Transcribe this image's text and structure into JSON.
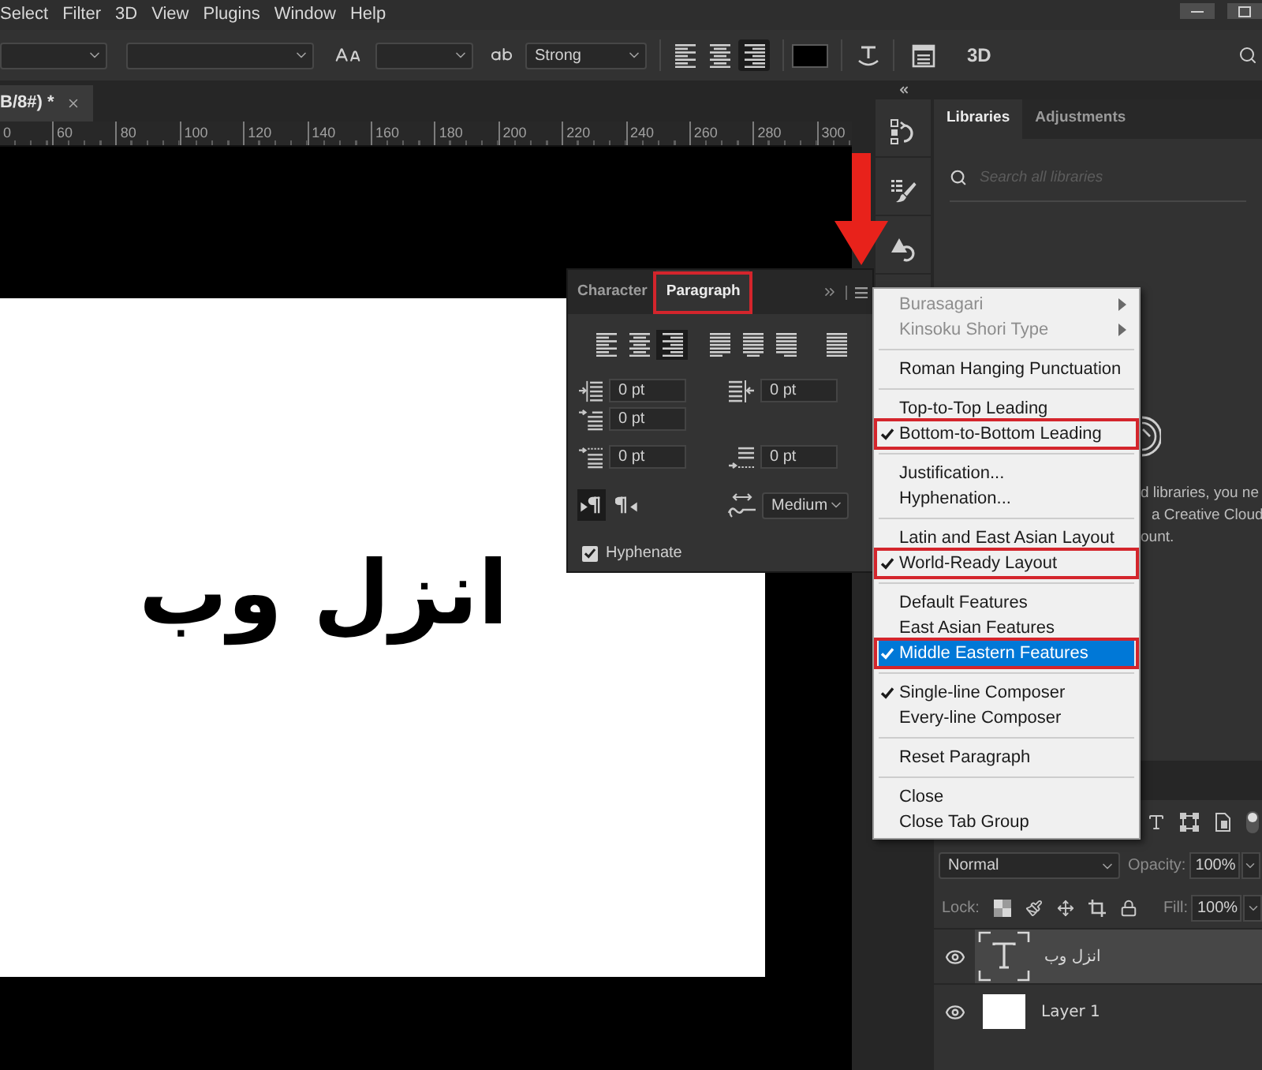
{
  "menu_bar": {
    "items": [
      "Select",
      "Filter",
      "3D",
      "View",
      "Plugins",
      "Window",
      "Help"
    ]
  },
  "options_bar": {
    "anti_aliasing": "Strong",
    "alignment": [
      {
        "selected": false
      },
      {
        "selected": false
      },
      {
        "selected": true
      }
    ],
    "three_d": "3D"
  },
  "document": {
    "tab_title": "B/8#) *",
    "ruler_labels": [
      "0",
      "60",
      "80",
      "100",
      "120",
      "140",
      "160",
      "180",
      "200",
      "220",
      "240",
      "260",
      "280",
      "300"
    ],
    "text": "انزل وب"
  },
  "libraries_panel": {
    "tabs": [
      {
        "label": "Libraries",
        "selected": true
      },
      {
        "label": "Adjustments",
        "selected": false
      }
    ],
    "search": {
      "placeholder": "Search all libraries"
    },
    "message_lines": [
      "d libraries, you ne",
      "a Creative Cloud",
      "ount."
    ]
  },
  "paragraph_panel": {
    "tabs": [
      {
        "label": "Character",
        "selected": false,
        "annotated": false
      },
      {
        "label": "Paragraph",
        "selected": true,
        "annotated": true
      }
    ],
    "alignment": [
      {
        "selected": false
      },
      {
        "selected": false
      },
      {
        "selected": true
      },
      {
        "selected": false
      },
      {
        "selected": false
      },
      {
        "selected": false
      },
      {
        "selected": false
      }
    ],
    "spacing_fields": [
      {
        "value": "0 pt"
      },
      {
        "value": "0 pt"
      },
      {
        "value": "0 pt"
      },
      {
        "value": "0 pt"
      },
      {
        "value": "0 pt"
      }
    ],
    "direction": [
      {
        "selected": true
      },
      {
        "selected": false
      }
    ],
    "justification_method": "Medium",
    "hyphenate": {
      "label": "Hyphenate",
      "checked": true
    }
  },
  "panel_menu": {
    "groups": [
      {
        "items": [
          {
            "label": "Burasagari",
            "checked": false,
            "disabled": true,
            "hovered": false,
            "annotated": false,
            "submenu": true
          },
          {
            "label": "Kinsoku Shori Type",
            "checked": false,
            "disabled": true,
            "hovered": false,
            "annotated": false,
            "submenu": true
          }
        ]
      },
      {
        "items": [
          {
            "label": "Roman Hanging Punctuation",
            "checked": false,
            "disabled": false,
            "hovered": false,
            "annotated": false,
            "submenu": false
          }
        ]
      },
      {
        "items": [
          {
            "label": "Top-to-Top Leading",
            "checked": false,
            "disabled": false,
            "hovered": false,
            "annotated": false,
            "submenu": false
          },
          {
            "label": "Bottom-to-Bottom Leading",
            "checked": true,
            "disabled": false,
            "hovered": false,
            "annotated": true,
            "submenu": false
          }
        ]
      },
      {
        "items": [
          {
            "label": "Justification...",
            "checked": false,
            "disabled": false,
            "hovered": false,
            "annotated": false,
            "submenu": false
          },
          {
            "label": "Hyphenation...",
            "checked": false,
            "disabled": false,
            "hovered": false,
            "annotated": false,
            "submenu": false
          }
        ]
      },
      {
        "items": [
          {
            "label": "Latin and East Asian Layout",
            "checked": false,
            "disabled": false,
            "hovered": false,
            "annotated": false,
            "submenu": false
          },
          {
            "label": "World-Ready Layout",
            "checked": true,
            "disabled": false,
            "hovered": false,
            "annotated": true,
            "submenu": false
          }
        ]
      },
      {
        "items": [
          {
            "label": "Default Features",
            "checked": false,
            "disabled": false,
            "hovered": false,
            "annotated": false,
            "submenu": false
          },
          {
            "label": "East Asian Features",
            "checked": false,
            "disabled": false,
            "hovered": false,
            "annotated": false,
            "submenu": false
          },
          {
            "label": "Middle Eastern Features",
            "checked": true,
            "disabled": false,
            "hovered": true,
            "annotated": true,
            "submenu": false
          }
        ]
      },
      {
        "items": [
          {
            "label": "Single-line Composer",
            "checked": true,
            "disabled": false,
            "hovered": false,
            "annotated": false,
            "submenu": false
          },
          {
            "label": "Every-line Composer",
            "checked": false,
            "disabled": false,
            "hovered": false,
            "annotated": false,
            "submenu": false
          }
        ]
      },
      {
        "items": [
          {
            "label": "Reset Paragraph",
            "checked": false,
            "disabled": false,
            "hovered": false,
            "annotated": false,
            "submenu": false
          }
        ]
      },
      {
        "items": [
          {
            "label": "Close",
            "checked": false,
            "disabled": false,
            "hovered": false,
            "annotated": false,
            "submenu": false
          },
          {
            "label": "Close Tab Group",
            "checked": false,
            "disabled": false,
            "hovered": false,
            "annotated": false,
            "submenu": false
          }
        ]
      }
    ]
  },
  "layers_panel": {
    "blend_mode": "Normal",
    "opacity": {
      "label": "Opacity:",
      "value": "100%"
    },
    "lock_label": "Lock:",
    "fill": {
      "label": "Fill:",
      "value": "100%"
    },
    "layers": [
      {
        "name": "انزل وب",
        "kind": "text",
        "selected": true,
        "visible": true
      },
      {
        "name": "Layer 1",
        "kind": "pixel",
        "selected": false,
        "visible": true
      }
    ]
  }
}
